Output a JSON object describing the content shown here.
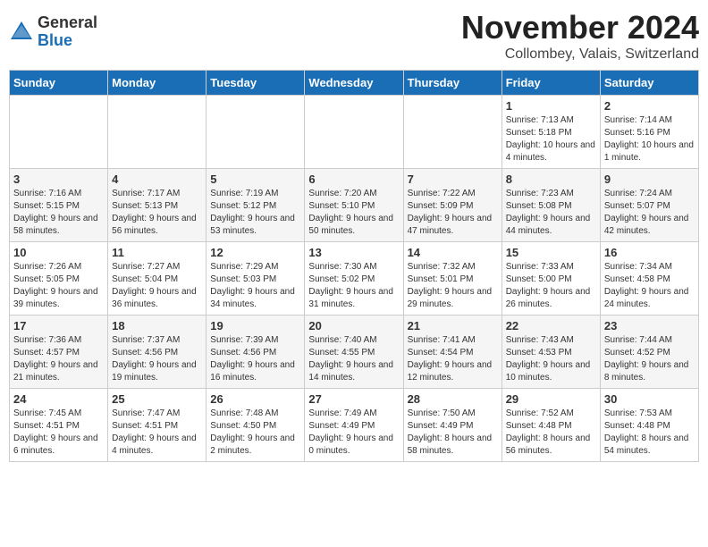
{
  "logo": {
    "general": "General",
    "blue": "Blue"
  },
  "title": "November 2024",
  "location": "Collombey, Valais, Switzerland",
  "days_of_week": [
    "Sunday",
    "Monday",
    "Tuesday",
    "Wednesday",
    "Thursday",
    "Friday",
    "Saturday"
  ],
  "weeks": [
    [
      {
        "day": "",
        "info": ""
      },
      {
        "day": "",
        "info": ""
      },
      {
        "day": "",
        "info": ""
      },
      {
        "day": "",
        "info": ""
      },
      {
        "day": "",
        "info": ""
      },
      {
        "day": "1",
        "info": "Sunrise: 7:13 AM\nSunset: 5:18 PM\nDaylight: 10 hours\nand 4 minutes."
      },
      {
        "day": "2",
        "info": "Sunrise: 7:14 AM\nSunset: 5:16 PM\nDaylight: 10 hours\nand 1 minute."
      }
    ],
    [
      {
        "day": "3",
        "info": "Sunrise: 7:16 AM\nSunset: 5:15 PM\nDaylight: 9 hours\nand 58 minutes."
      },
      {
        "day": "4",
        "info": "Sunrise: 7:17 AM\nSunset: 5:13 PM\nDaylight: 9 hours\nand 56 minutes."
      },
      {
        "day": "5",
        "info": "Sunrise: 7:19 AM\nSunset: 5:12 PM\nDaylight: 9 hours\nand 53 minutes."
      },
      {
        "day": "6",
        "info": "Sunrise: 7:20 AM\nSunset: 5:10 PM\nDaylight: 9 hours\nand 50 minutes."
      },
      {
        "day": "7",
        "info": "Sunrise: 7:22 AM\nSunset: 5:09 PM\nDaylight: 9 hours\nand 47 minutes."
      },
      {
        "day": "8",
        "info": "Sunrise: 7:23 AM\nSunset: 5:08 PM\nDaylight: 9 hours\nand 44 minutes."
      },
      {
        "day": "9",
        "info": "Sunrise: 7:24 AM\nSunset: 5:07 PM\nDaylight: 9 hours\nand 42 minutes."
      }
    ],
    [
      {
        "day": "10",
        "info": "Sunrise: 7:26 AM\nSunset: 5:05 PM\nDaylight: 9 hours\nand 39 minutes."
      },
      {
        "day": "11",
        "info": "Sunrise: 7:27 AM\nSunset: 5:04 PM\nDaylight: 9 hours\nand 36 minutes."
      },
      {
        "day": "12",
        "info": "Sunrise: 7:29 AM\nSunset: 5:03 PM\nDaylight: 9 hours\nand 34 minutes."
      },
      {
        "day": "13",
        "info": "Sunrise: 7:30 AM\nSunset: 5:02 PM\nDaylight: 9 hours\nand 31 minutes."
      },
      {
        "day": "14",
        "info": "Sunrise: 7:32 AM\nSunset: 5:01 PM\nDaylight: 9 hours\nand 29 minutes."
      },
      {
        "day": "15",
        "info": "Sunrise: 7:33 AM\nSunset: 5:00 PM\nDaylight: 9 hours\nand 26 minutes."
      },
      {
        "day": "16",
        "info": "Sunrise: 7:34 AM\nSunset: 4:58 PM\nDaylight: 9 hours\nand 24 minutes."
      }
    ],
    [
      {
        "day": "17",
        "info": "Sunrise: 7:36 AM\nSunset: 4:57 PM\nDaylight: 9 hours\nand 21 minutes."
      },
      {
        "day": "18",
        "info": "Sunrise: 7:37 AM\nSunset: 4:56 PM\nDaylight: 9 hours\nand 19 minutes."
      },
      {
        "day": "19",
        "info": "Sunrise: 7:39 AM\nSunset: 4:56 PM\nDaylight: 9 hours\nand 16 minutes."
      },
      {
        "day": "20",
        "info": "Sunrise: 7:40 AM\nSunset: 4:55 PM\nDaylight: 9 hours\nand 14 minutes."
      },
      {
        "day": "21",
        "info": "Sunrise: 7:41 AM\nSunset: 4:54 PM\nDaylight: 9 hours\nand 12 minutes."
      },
      {
        "day": "22",
        "info": "Sunrise: 7:43 AM\nSunset: 4:53 PM\nDaylight: 9 hours\nand 10 minutes."
      },
      {
        "day": "23",
        "info": "Sunrise: 7:44 AM\nSunset: 4:52 PM\nDaylight: 9 hours\nand 8 minutes."
      }
    ],
    [
      {
        "day": "24",
        "info": "Sunrise: 7:45 AM\nSunset: 4:51 PM\nDaylight: 9 hours\nand 6 minutes."
      },
      {
        "day": "25",
        "info": "Sunrise: 7:47 AM\nSunset: 4:51 PM\nDaylight: 9 hours\nand 4 minutes."
      },
      {
        "day": "26",
        "info": "Sunrise: 7:48 AM\nSunset: 4:50 PM\nDaylight: 9 hours\nand 2 minutes."
      },
      {
        "day": "27",
        "info": "Sunrise: 7:49 AM\nSunset: 4:49 PM\nDaylight: 9 hours\nand 0 minutes."
      },
      {
        "day": "28",
        "info": "Sunrise: 7:50 AM\nSunset: 4:49 PM\nDaylight: 8 hours\nand 58 minutes."
      },
      {
        "day": "29",
        "info": "Sunrise: 7:52 AM\nSunset: 4:48 PM\nDaylight: 8 hours\nand 56 minutes."
      },
      {
        "day": "30",
        "info": "Sunrise: 7:53 AM\nSunset: 4:48 PM\nDaylight: 8 hours\nand 54 minutes."
      }
    ]
  ]
}
